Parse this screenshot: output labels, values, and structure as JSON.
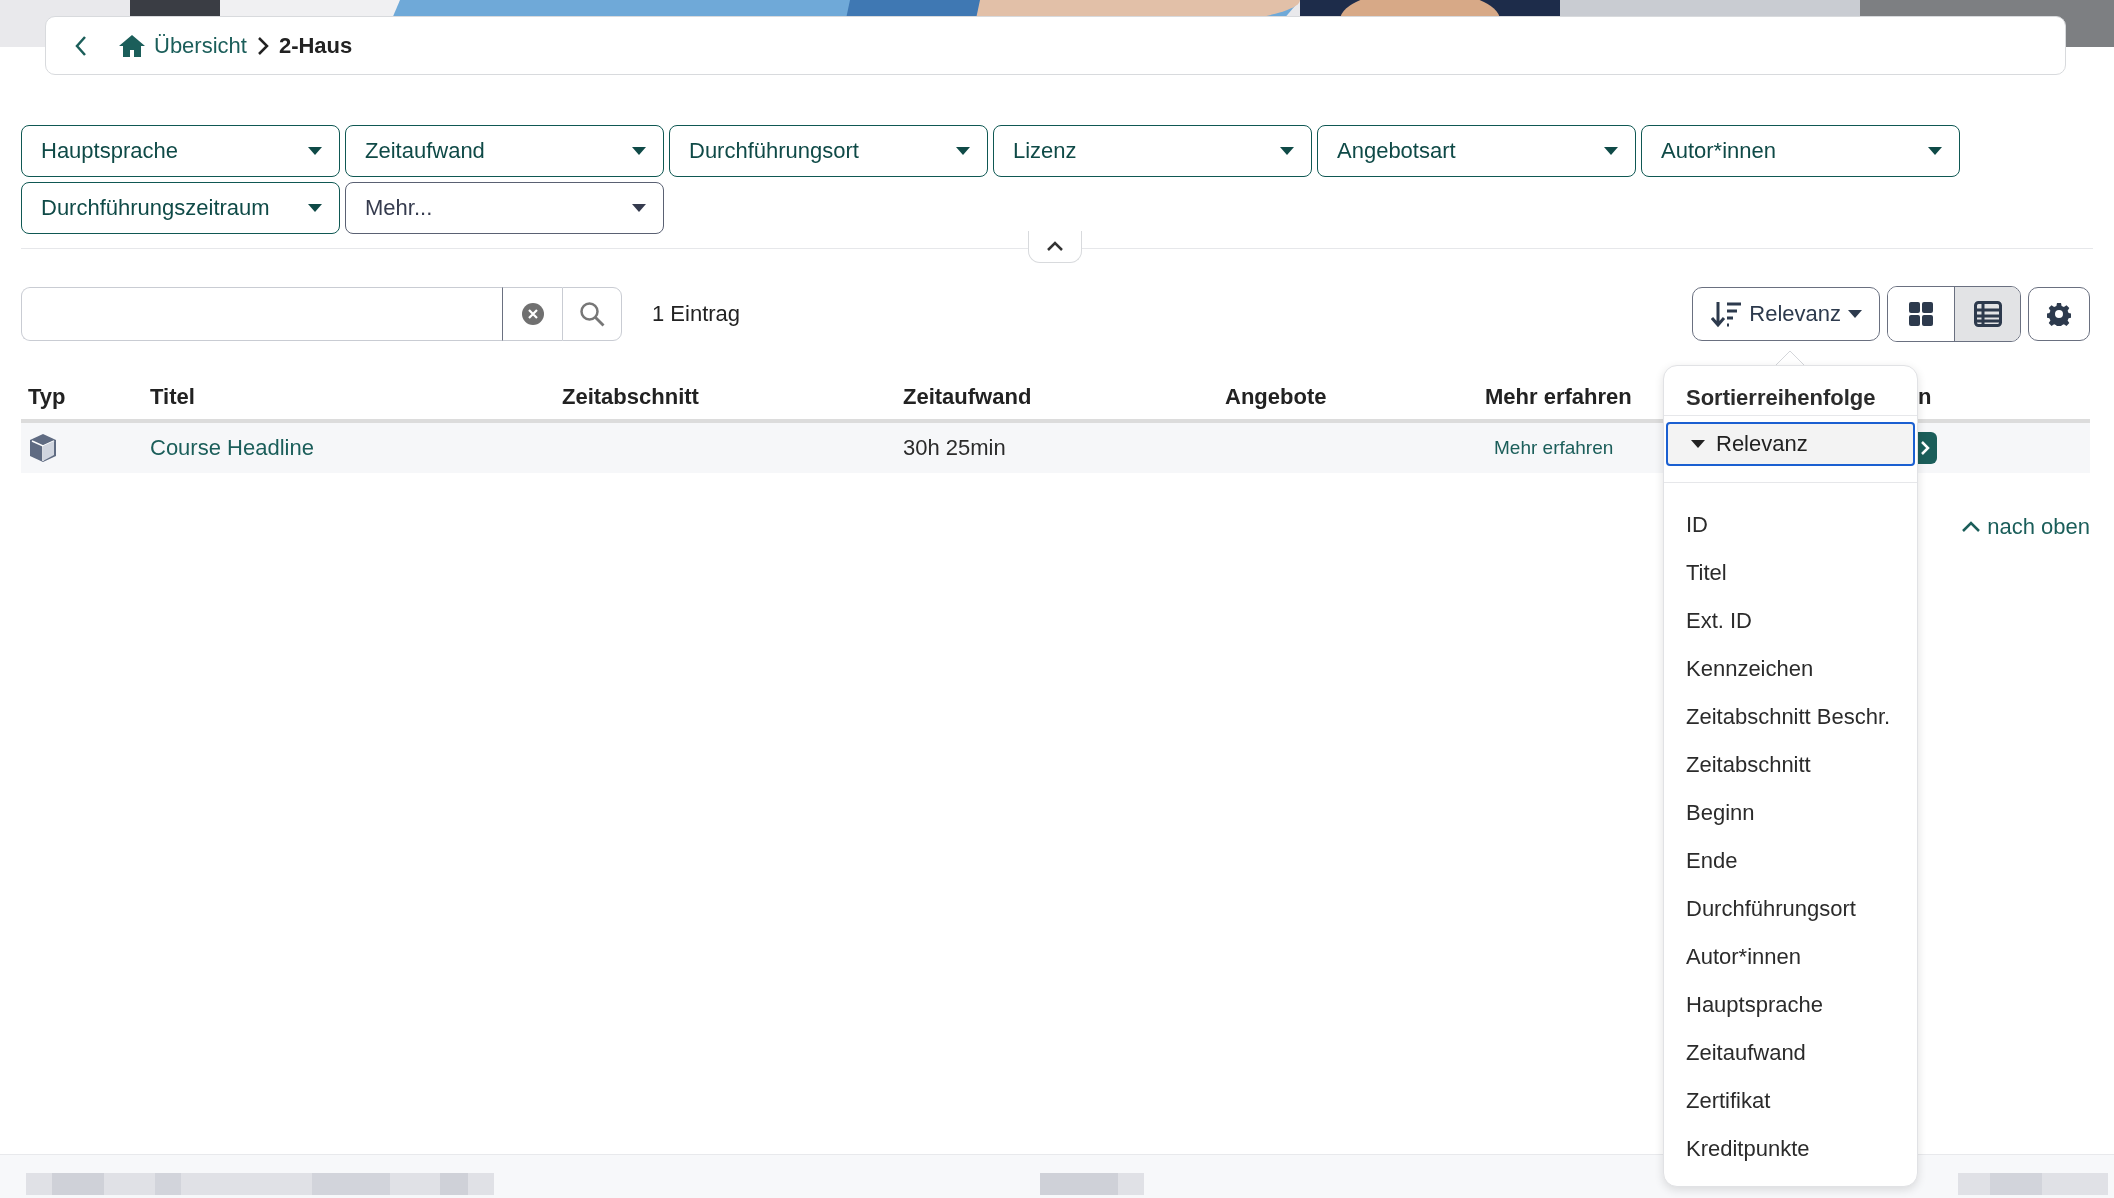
{
  "breadcrumb": {
    "items": [
      {
        "label": "Übersicht",
        "kind": "home"
      },
      {
        "label": "2-Haus",
        "kind": "current"
      }
    ]
  },
  "filters": [
    {
      "label": "Hauptsprache",
      "kind": "filter"
    },
    {
      "label": "Zeitaufwand",
      "kind": "filter"
    },
    {
      "label": "Durchführungsort",
      "kind": "filter"
    },
    {
      "label": "Lizenz",
      "kind": "filter"
    },
    {
      "label": "Angebotsart",
      "kind": "filter"
    },
    {
      "label": "Autor*innen",
      "kind": "filter"
    },
    {
      "label": "Durchführungszeitraum",
      "kind": "filter"
    },
    {
      "label": "Mehr...",
      "kind": "more"
    }
  ],
  "toolbar": {
    "count": "1 Eintrag",
    "sort_label": "Relevanz",
    "views": [
      {
        "kind": "grid",
        "selected": false
      },
      {
        "kind": "list",
        "selected": true
      }
    ]
  },
  "table": {
    "columns": [
      "Typ",
      "Titel",
      "Zeitabschnitt",
      "Zeitaufwand",
      "Angebote",
      "Mehr erfahren",
      "n"
    ],
    "rows": [
      {
        "title": "Course Headline",
        "duration": "30h 25min",
        "link": "Mehr erfahren"
      }
    ]
  },
  "sort_menu": {
    "title": "Sortierreihenfolge",
    "current": "Relevanz",
    "options": [
      "ID",
      "Titel",
      "Ext. ID",
      "Kennzeichen",
      "Zeitabschnitt Beschr.",
      "Zeitabschnitt",
      "Beginn",
      "Ende",
      "Durchführungsort",
      "Autor*innen",
      "Hauptsprache",
      "Zeitaufwand",
      "Zertifikat",
      "Kreditpunkte"
    ]
  },
  "back_to_top": "nach oben"
}
